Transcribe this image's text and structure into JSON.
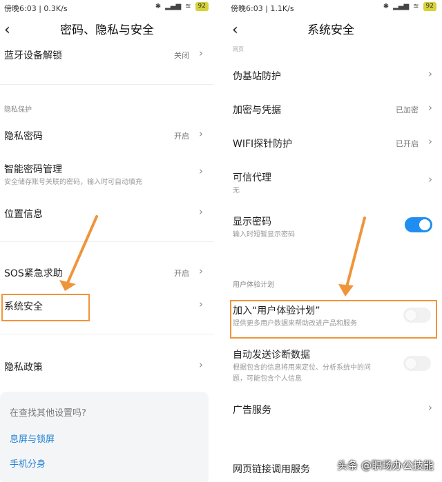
{
  "left": {
    "status_left": "傍晚6:03 | 0.3K/s",
    "battery": "92",
    "title": "密码、隐私与安全",
    "items": {
      "bluetooth_unlock": {
        "label": "蓝牙设备解锁",
        "value": "关闭"
      },
      "privacy_section": "隐私保护",
      "privacy_password": {
        "label": "隐私密码",
        "value": "开启"
      },
      "smart_password": {
        "label": "智能密码管理",
        "sub": "安全储存账号关联的密码，输入时可自动填充"
      },
      "location": {
        "label": "位置信息"
      },
      "sos": {
        "label": "SOS紧急求助",
        "value": "开启"
      },
      "system_security": {
        "label": "系统安全"
      },
      "privacy_policy": {
        "label": "隐私政策"
      }
    },
    "search_card": {
      "title": "在查找其他设置吗?",
      "link1": "息屏与锁屏",
      "link2": "手机分身"
    }
  },
  "right": {
    "status_left": "傍晚6:03 | 1.1K/s",
    "battery": "92",
    "title": "系统安全",
    "top_cut": "网页",
    "items": {
      "pseudo_bs": {
        "label": "伪基站防护"
      },
      "encryption": {
        "label": "加密与凭据",
        "value": "已加密"
      },
      "wifi_probe": {
        "label": "WIFI探针防护",
        "value": "已开启"
      },
      "trusted_agent": {
        "label": "可信代理",
        "sub": "无"
      },
      "show_password": {
        "label": "显示密码",
        "sub": "输入时短暂显示密码",
        "on": true
      },
      "ux_section": "用户体验计划",
      "join_ux": {
        "label": "加入“用户体验计划”",
        "sub": "提供更多用户数据来帮助改进产品和服务",
        "on": false
      },
      "auto_diag": {
        "label": "自动发送诊断数据",
        "sub1": "根据包含的信息将用来定位、分析系统中的问",
        "sub2": "题，可能包含个人信息",
        "on": false
      },
      "ads": {
        "label": "广告服务"
      },
      "web_link": {
        "label": "网页链接调用服务"
      }
    }
  },
  "watermark": "头条 @职场办公技能",
  "colors": {
    "accent": "#1f8ef0",
    "highlight": "#f0943a",
    "link": "#1f7fd6"
  }
}
